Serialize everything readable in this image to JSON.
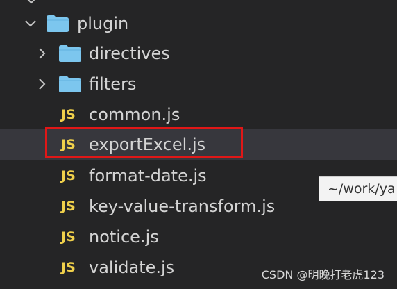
{
  "explorer": {
    "items": [
      {
        "label": "plugin",
        "type": "folder",
        "expanded": true
      },
      {
        "label": "directives",
        "type": "folder",
        "expanded": false
      },
      {
        "label": "filters",
        "type": "folder",
        "expanded": false
      },
      {
        "label": "common.js",
        "type": "file",
        "badge": "JS"
      },
      {
        "label": "exportExcel.js",
        "type": "file",
        "badge": "JS",
        "selected": true,
        "highlighted": true
      },
      {
        "label": "format-date.js",
        "type": "file",
        "badge": "JS"
      },
      {
        "label": "key-value-transform.js",
        "type": "file",
        "badge": "JS"
      },
      {
        "label": "notice.js",
        "type": "file",
        "badge": "JS"
      },
      {
        "label": "validate.js",
        "type": "file",
        "badge": "JS"
      }
    ]
  },
  "tooltip": {
    "text": "~/work/ya"
  },
  "watermark": {
    "text": "CSDN @明晚打老虎123"
  },
  "colors": {
    "background": "#252526",
    "selected_row": "#37373d",
    "folder": "#7cc6ee",
    "js_badge": "#f0d04b",
    "highlight_border": "#e01717",
    "text": "#d4d4d4"
  },
  "icons": {
    "folder": "folder-icon",
    "chevron_expanded": "chevron-down-icon",
    "chevron_collapsed": "chevron-right-icon",
    "file": "js-file-icon"
  }
}
